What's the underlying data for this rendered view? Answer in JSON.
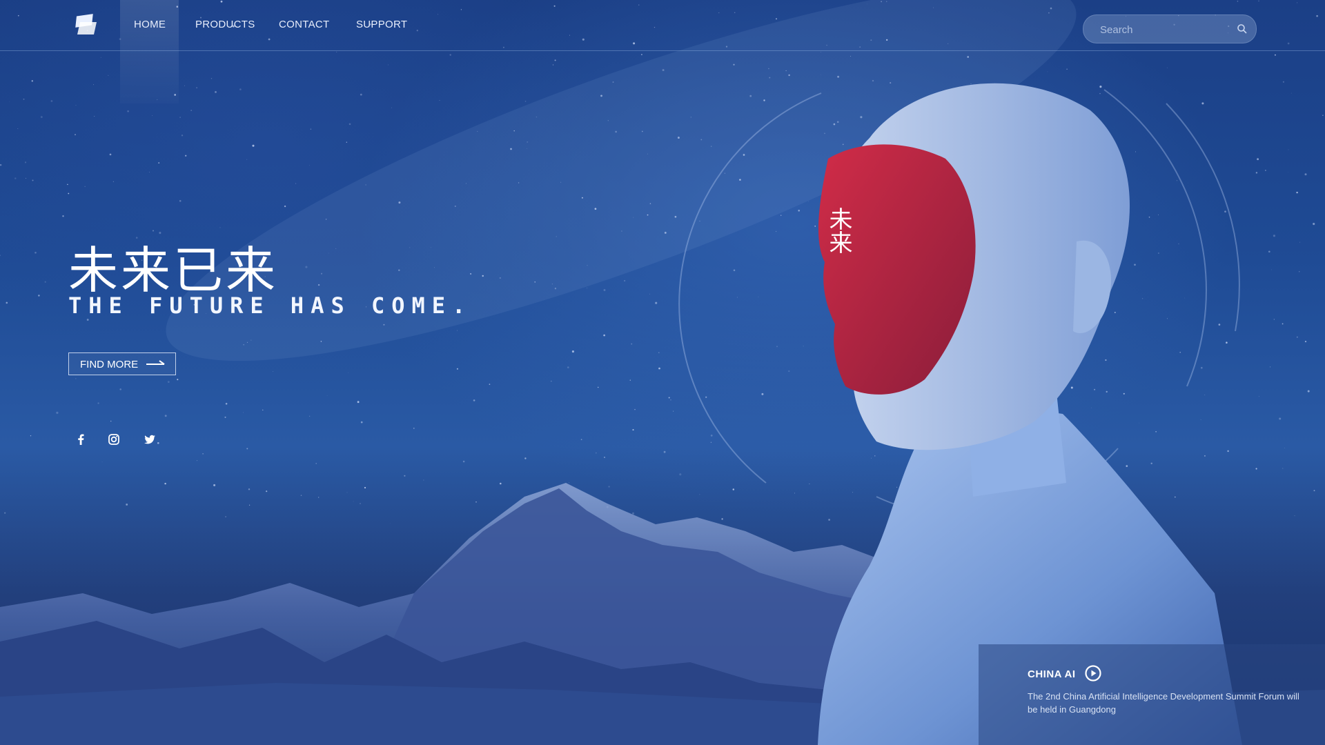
{
  "nav": {
    "items": [
      {
        "label": "HOME"
      },
      {
        "label": "PRODUCTS"
      },
      {
        "label": "CONTACT"
      },
      {
        "label": "SUPPORT"
      }
    ],
    "search_placeholder": "Search"
  },
  "hero": {
    "title_cn": "未来已来",
    "title_en": "THE FUTURE HAS COME.",
    "cta_label": "FIND MORE",
    "mask_glyph": "未来"
  },
  "social": [
    "facebook-icon",
    "instagram-icon",
    "twitter-icon"
  ],
  "news": {
    "title": "CHINA AI",
    "text": "The 2nd China Artificial Intelligence Development Summit Forum will be held in Guangdong"
  },
  "colors": {
    "background": "#1f4b95",
    "mask_red": "#b8233f",
    "text": "#ffffff"
  }
}
